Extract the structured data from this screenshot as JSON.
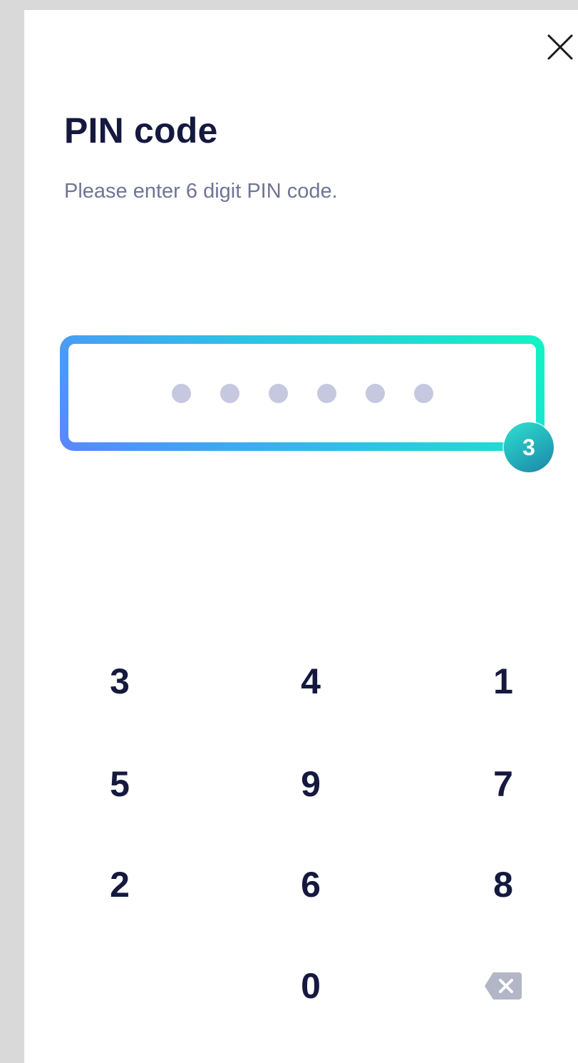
{
  "header": {
    "close_icon": "close-icon"
  },
  "title": "PIN code",
  "subtitle": "Please enter 6 digit PIN code.",
  "pin": {
    "length": 6,
    "filled": 0,
    "dot_color": "#c5c8df"
  },
  "highlight": {
    "badge": "3",
    "gradient_colors": [
      "#5a86ff",
      "#2bc3e6",
      "#12f4c2"
    ]
  },
  "keypad": {
    "rows": [
      [
        "3",
        "4",
        "1"
      ],
      [
        "5",
        "9",
        "7"
      ],
      [
        "2",
        "6",
        "8"
      ],
      [
        "",
        "0",
        "backspace"
      ]
    ],
    "backspace_icon": "backspace-icon"
  },
  "colors": {
    "text_primary": "#15193f",
    "text_secondary": "#707595",
    "backspace_fill": "#b3b6c6"
  }
}
